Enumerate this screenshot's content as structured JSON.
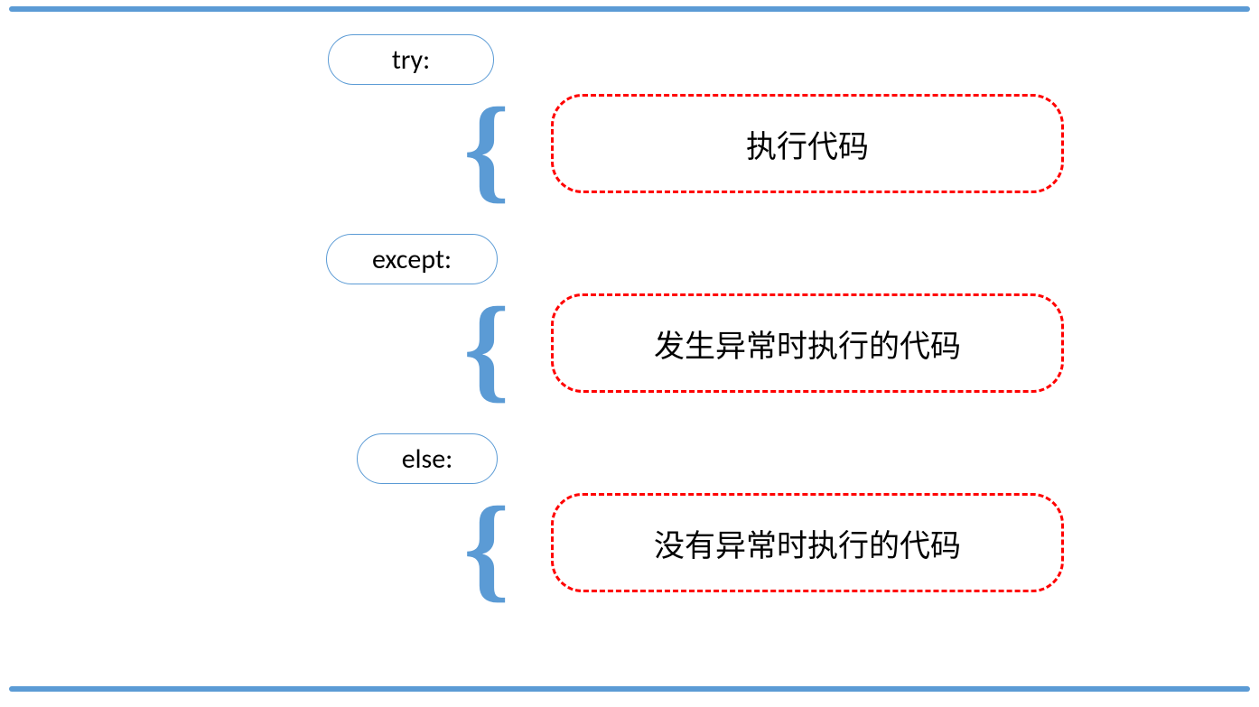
{
  "keywords": {
    "try": "try:",
    "except": "except:",
    "else": "else:"
  },
  "descriptions": {
    "try": "执行代码",
    "except": "发生异常时执行的代码",
    "else": "没有异常时执行的代码"
  }
}
